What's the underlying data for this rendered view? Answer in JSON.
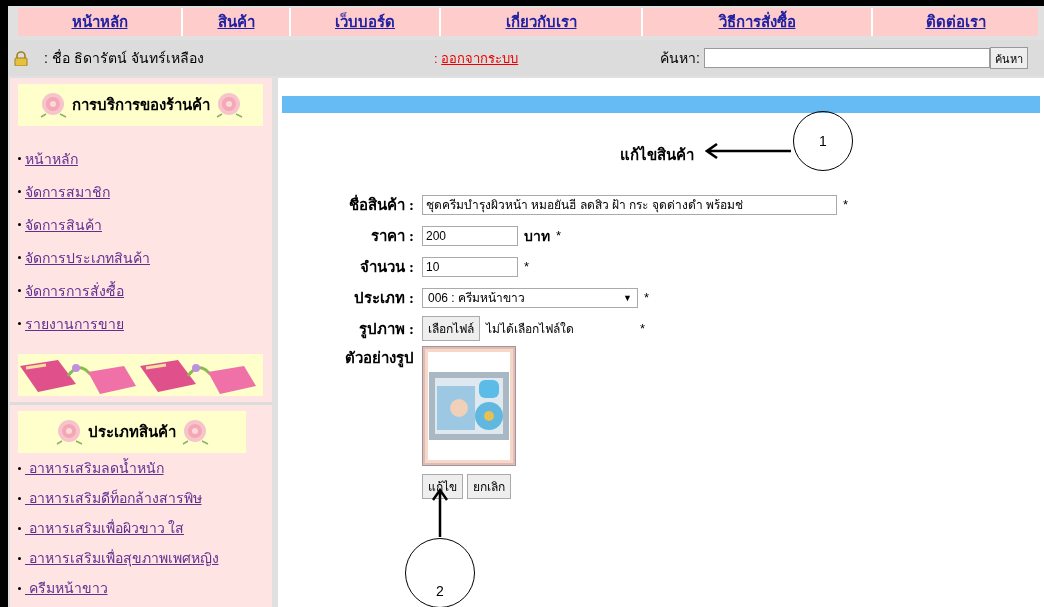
{
  "nav": [
    {
      "label": "หน้าหลัก"
    },
    {
      "label": "สินค้า"
    },
    {
      "label": "เว็บบอร์ด"
    },
    {
      "label": "เกี่ยวกับเรา"
    },
    {
      "label": "วิธีการสั่งซื้อ"
    },
    {
      "label": "ติดต่อเรา"
    }
  ],
  "user_bar": {
    "user": ": ชื่อ ธิดารัตน์ จันทร์เหลือง",
    "logout_prefix": ":",
    "logout": "ออกจากระบบ",
    "search_label": "ค้นหา:",
    "search_button": "ค้นหา"
  },
  "sidebar": [
    {
      "title": "การบริการของร้านค้า",
      "items": [
        "หน้าหลัก",
        "จัดการสมาชิก",
        "จัดการสินค้า",
        "จัดการประเภทสินค้า",
        "จัดการการสั่งซื้อ",
        "รายงานการขาย"
      ]
    },
    {
      "title": "ประเภทสินค้า",
      "items": [
        " อาหารเสริมลดน้ำหนัก",
        " อาหารเสริมดีท็อกล้างสารพิษ",
        " อาหารเสริมเพื่อผิวขาว ใส",
        " อาหารเสริมเพื่อสุขภาพเพศหญิง",
        " ครีมหน้าขาว"
      ]
    }
  ],
  "form": {
    "title": "แก้ไขสินค้า",
    "fields": [
      {
        "kind": "text",
        "label": "ชื่อสินค้า :",
        "value": "ชุดครีมบำรุงผิวหน้า หมอยันฮี ลดสิว ฝ้า กระ จุดด่างดำ พร้อมช่",
        "required": "*"
      },
      {
        "kind": "short",
        "label": "ราคา :",
        "value": "200",
        "unit": "บาท",
        "required": "*"
      },
      {
        "kind": "short",
        "label": "จำนวน :",
        "value": "10",
        "required": "*"
      },
      {
        "kind": "select",
        "label": "ประเภท :",
        "value": "006 : ครีมหน้าขาว",
        "arrow": "▼",
        "required": "*"
      },
      {
        "kind": "file",
        "label": "รูปภาพ :",
        "button": "เลือกไฟล์",
        "status": "ไม่ได้เลือกไฟล์ใด",
        "required": "*"
      }
    ],
    "preview_label": "ตัวอย่างรูป",
    "buttons": [
      "แก้ไข",
      "ยกเลิก"
    ]
  },
  "annotations": [
    {
      "label": "1"
    },
    {
      "label": "2"
    }
  ]
}
